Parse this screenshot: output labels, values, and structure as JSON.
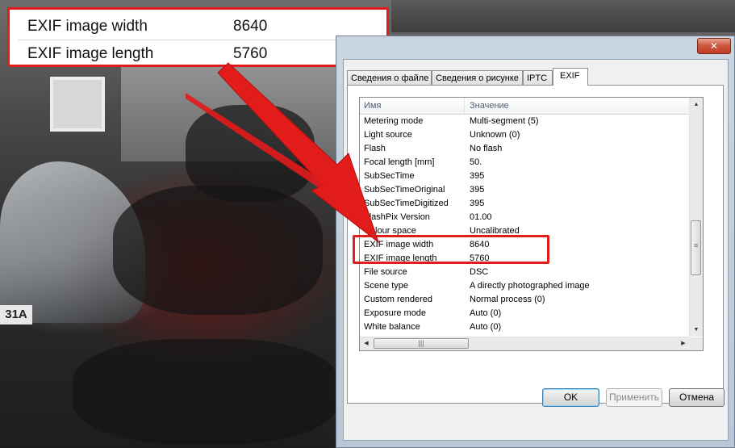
{
  "callout": {
    "rows": [
      {
        "name": "EXIF image width",
        "value": "8640"
      },
      {
        "name": "EXIF image length",
        "value": "5760"
      }
    ]
  },
  "background": {
    "plate_text": "31A"
  },
  "dialog": {
    "close_glyph": "✕",
    "tabs": [
      {
        "label": "Сведения о файле",
        "active": false
      },
      {
        "label": "Сведения о рисунке",
        "active": false
      },
      {
        "label": "IPTC",
        "active": false
      },
      {
        "label": "EXIF",
        "active": true
      }
    ],
    "columns": {
      "name": "Имя",
      "value": "Значение"
    },
    "rows": [
      {
        "name": "Metering mode",
        "value": "Multi-segment (5)"
      },
      {
        "name": "Light source",
        "value": "Unknown (0)"
      },
      {
        "name": "Flash",
        "value": "No flash"
      },
      {
        "name": "Focal length [mm]",
        "value": "50."
      },
      {
        "name": "SubSecTime",
        "value": "395"
      },
      {
        "name": "SubSecTimeOriginal",
        "value": "395"
      },
      {
        "name": "SubSecTimeDigitized",
        "value": "395"
      },
      {
        "name": "FlashPix Version",
        "value": "01.00"
      },
      {
        "name": "Colour space",
        "value": "Uncalibrated"
      },
      {
        "name": "EXIF image width",
        "value": "8640"
      },
      {
        "name": "EXIF image length",
        "value": "5760"
      },
      {
        "name": "File source",
        "value": "DSC"
      },
      {
        "name": "Scene type",
        "value": "A directly photographed image"
      },
      {
        "name": "Custom rendered",
        "value": "Normal process (0)"
      },
      {
        "name": "Exposure mode",
        "value": "Auto (0)"
      },
      {
        "name": "White balance",
        "value": "Auto (0)"
      }
    ],
    "buttons": {
      "ok": "OK",
      "apply": "Применить",
      "cancel": "Отмена"
    },
    "colors": {
      "highlight": "#e21b1b",
      "arrow": "#e21b1b"
    }
  }
}
